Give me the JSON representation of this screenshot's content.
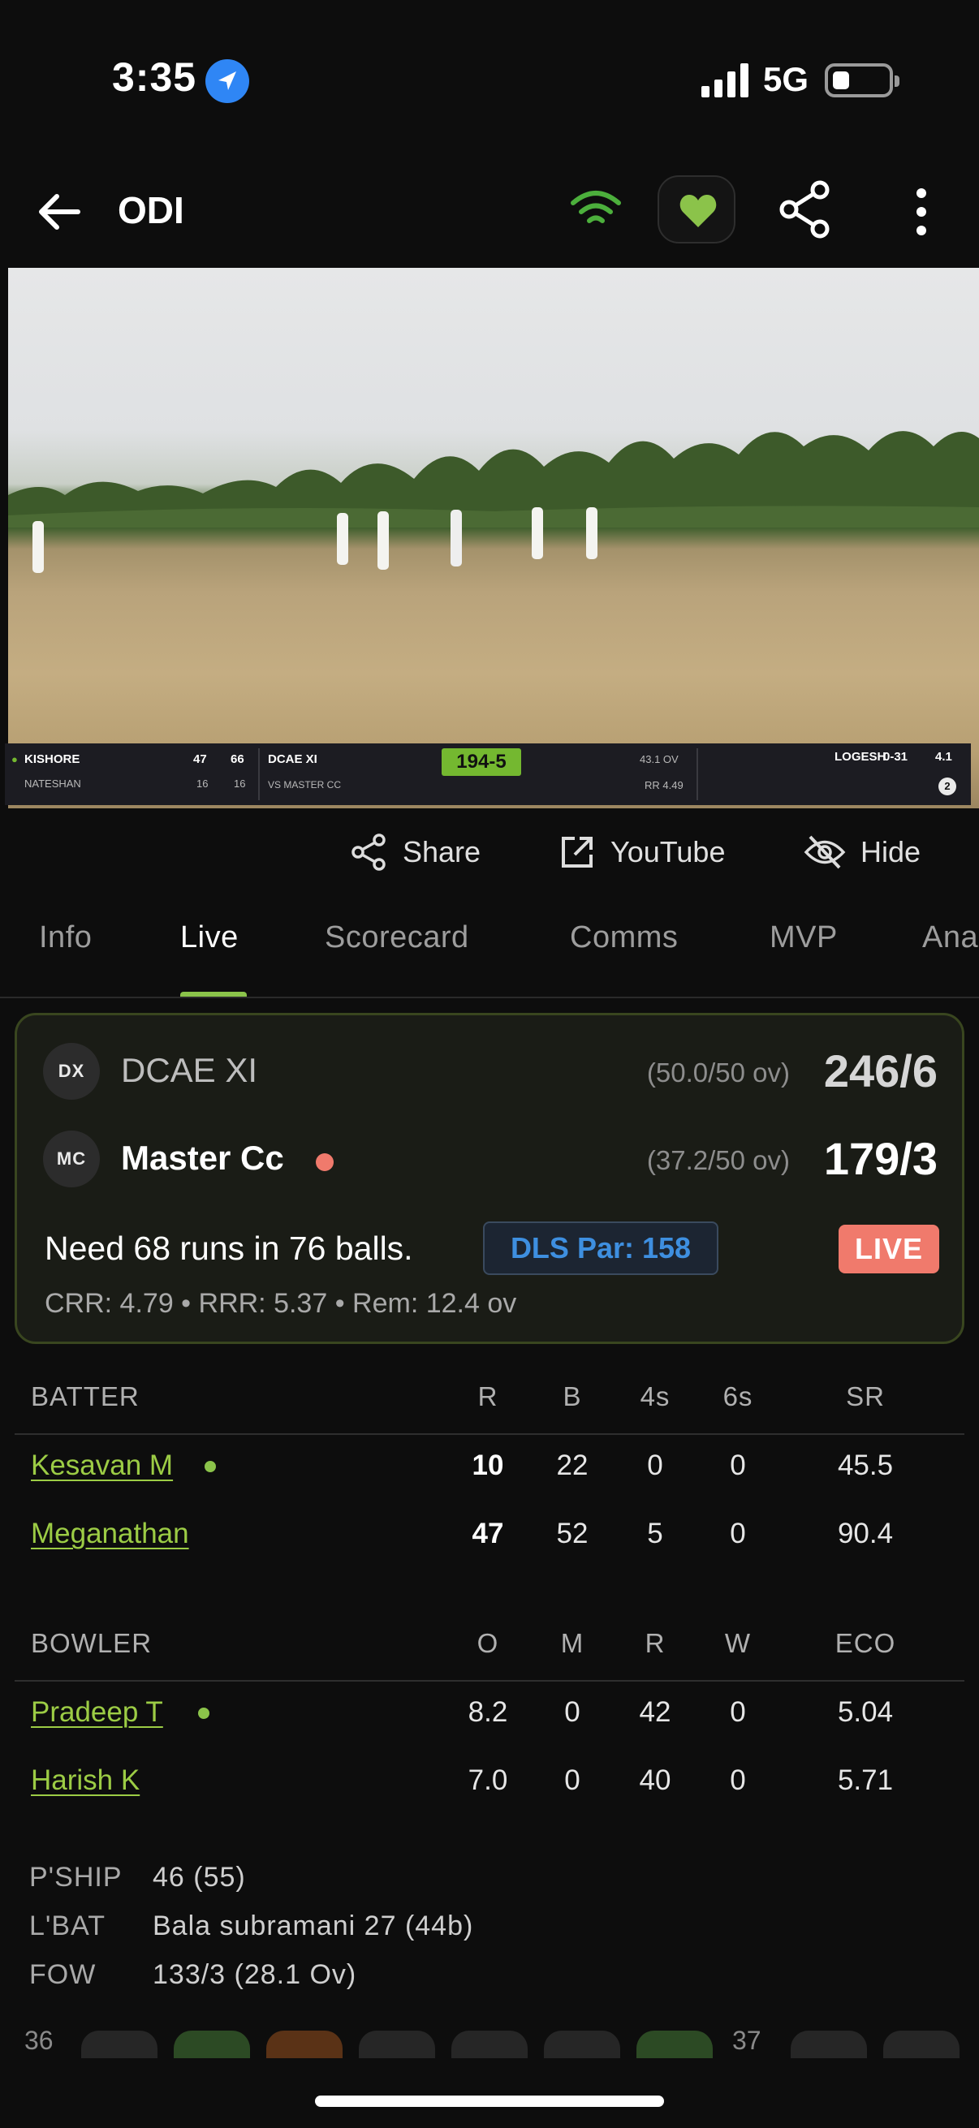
{
  "status": {
    "time": "3:35",
    "network": "5G"
  },
  "header": {
    "title": "ODI"
  },
  "scorebug": {
    "striker": "KISHORE",
    "striker_runs": "47",
    "striker_balls": "66",
    "nonstriker": "NATESHAN",
    "nonstriker_runs": "16",
    "nonstriker_balls": "16",
    "team": "DCAE XI",
    "vs": "VS MASTER CC",
    "score": "194-5",
    "overs": "43.1 OV",
    "rr": "RR 4.49",
    "bowler": "LOGESH",
    "bowler_figures": "0-31",
    "bowler_overs": "4.1",
    "ball": "2"
  },
  "actions": {
    "share": "Share",
    "youtube": "YouTube",
    "hide": "Hide"
  },
  "tabs": [
    {
      "label": "Info"
    },
    {
      "label": "Live"
    },
    {
      "label": "Scorecard"
    },
    {
      "label": "Comms"
    },
    {
      "label": "MVP"
    },
    {
      "label": "Ana"
    }
  ],
  "match": {
    "team1": {
      "badge": "DX",
      "name": "DCAE XI",
      "overs": "(50.0/50 ov)",
      "score": "246/6"
    },
    "team2": {
      "badge": "MC",
      "name": "Master Cc",
      "overs": "(37.2/50 ov)",
      "score": "179/3"
    },
    "need": "Need 68 runs in 76 balls.",
    "dls": "DLS Par: 158",
    "live": "LIVE",
    "rates": "CRR: 4.79 • RRR: 5.37 • Rem: 12.4 ov"
  },
  "batting": {
    "headers": [
      "BATTER",
      "R",
      "B",
      "4s",
      "6s",
      "SR"
    ],
    "rows": [
      {
        "name": "Kesavan M",
        "r": "10",
        "b": "22",
        "fours": "0",
        "sixes": "0",
        "sr": "45.5"
      },
      {
        "name": "Meganathan",
        "r": "47",
        "b": "52",
        "fours": "5",
        "sixes": "0",
        "sr": "90.4"
      }
    ]
  },
  "bowling": {
    "headers": [
      "BOWLER",
      "O",
      "M",
      "R",
      "W",
      "ECO"
    ],
    "rows": [
      {
        "name": "Pradeep T",
        "o": "8.2",
        "m": "0",
        "r": "42",
        "w": "0",
        "eco": "5.04"
      },
      {
        "name": "Harish K",
        "o": "7.0",
        "m": "0",
        "r": "40",
        "w": "0",
        "eco": "5.71"
      }
    ]
  },
  "extra": {
    "pship_label": "P'SHIP",
    "pship": "46 (55)",
    "lbat_label": "L'BAT",
    "lbat": "Bala subramani 27 (44b)",
    "fow_label": "FOW",
    "fow": "133/3 (28.1 Ov)"
  },
  "overs_strip": {
    "over_a": "36",
    "over_b": "37"
  },
  "colors": {
    "accent": "#8bc34a",
    "live": "#f07a6c",
    "dls": "#3e8fe0"
  }
}
